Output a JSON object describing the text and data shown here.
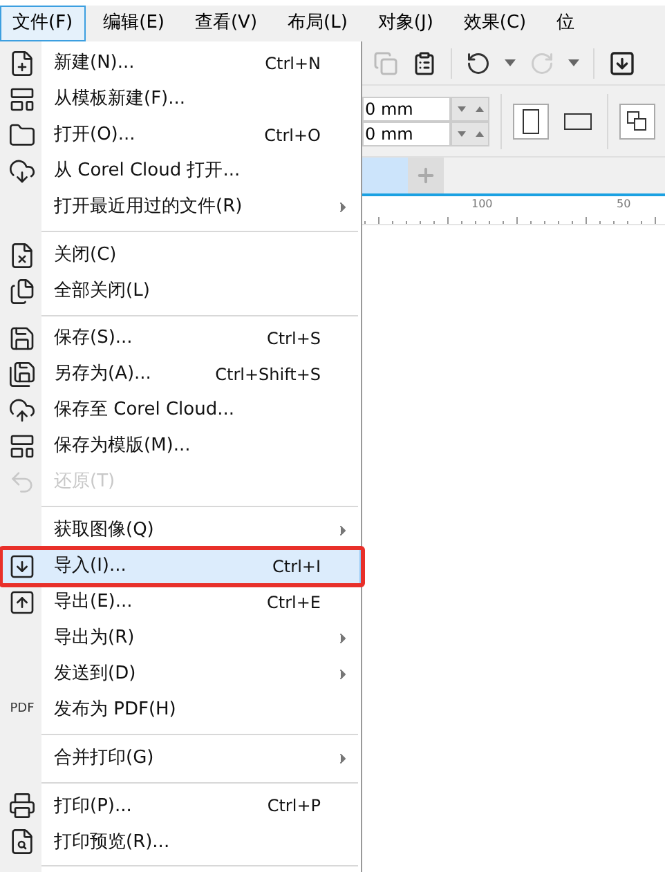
{
  "menubar": [
    {
      "label": "文件(F)",
      "selected": true
    },
    {
      "label": "编辑(E)",
      "selected": false
    },
    {
      "label": "查看(V)",
      "selected": false
    },
    {
      "label": "布局(L)",
      "selected": false
    },
    {
      "label": "对象(J)",
      "selected": false
    },
    {
      "label": "效果(C)",
      "selected": false
    },
    {
      "label": "位",
      "selected": false
    }
  ],
  "menu": [
    {
      "kind": "item",
      "label": "新建(N)...",
      "shortcut": "Ctrl+N",
      "submenu": false,
      "disabled": false,
      "selected": false,
      "outlined": false
    },
    {
      "kind": "item",
      "label": "从模板新建(F)...",
      "submenu": false,
      "disabled": false,
      "selected": false,
      "outlined": false
    },
    {
      "kind": "item",
      "label": "打开(O)...",
      "shortcut": "Ctrl+O",
      "submenu": false,
      "disabled": false,
      "selected": false,
      "outlined": false
    },
    {
      "kind": "item",
      "label": "从 Corel Cloud 打开...",
      "submenu": false,
      "disabled": false,
      "selected": false,
      "outlined": false
    },
    {
      "kind": "item",
      "label": "打开最近用过的文件(R)",
      "submenu": true,
      "disabled": false,
      "selected": false,
      "outlined": false
    },
    {
      "kind": "separator"
    },
    {
      "kind": "item",
      "label": "关闭(C)",
      "submenu": false,
      "disabled": false,
      "selected": false,
      "outlined": false
    },
    {
      "kind": "item",
      "label": "全部关闭(L)",
      "submenu": false,
      "disabled": false,
      "selected": false,
      "outlined": false
    },
    {
      "kind": "separator"
    },
    {
      "kind": "item",
      "label": "保存(S)...",
      "shortcut": "Ctrl+S",
      "submenu": false,
      "disabled": false,
      "selected": false,
      "outlined": false
    },
    {
      "kind": "item",
      "label": "另存为(A)...",
      "shortcut": "Ctrl+Shift+S",
      "submenu": false,
      "disabled": false,
      "selected": false,
      "outlined": false
    },
    {
      "kind": "item",
      "label": "保存至 Corel Cloud...",
      "submenu": false,
      "disabled": false,
      "selected": false,
      "outlined": false
    },
    {
      "kind": "item",
      "label": "保存为模版(M)...",
      "submenu": false,
      "disabled": false,
      "selected": false,
      "outlined": false
    },
    {
      "kind": "item",
      "label": "还原(T)",
      "submenu": false,
      "disabled": true,
      "selected": false,
      "outlined": false
    },
    {
      "kind": "separator"
    },
    {
      "kind": "item",
      "label": "获取图像(Q)",
      "submenu": true,
      "disabled": false,
      "selected": false,
      "outlined": false
    },
    {
      "kind": "item",
      "label": "导入(I)...",
      "shortcut": "Ctrl+I",
      "submenu": false,
      "disabled": false,
      "selected": true,
      "outlined": true
    },
    {
      "kind": "item",
      "label": "导出(E)...",
      "shortcut": "Ctrl+E",
      "submenu": false,
      "disabled": false,
      "selected": false,
      "outlined": false
    },
    {
      "kind": "item",
      "label": "导出为(R)",
      "submenu": true,
      "disabled": false,
      "selected": false,
      "outlined": false
    },
    {
      "kind": "item",
      "label": "发送到(D)",
      "submenu": true,
      "disabled": false,
      "selected": false,
      "outlined": false
    },
    {
      "kind": "item",
      "label": "发布为 PDF(H)",
      "icon_label": "PDF",
      "submenu": false,
      "disabled": false,
      "selected": false,
      "outlined": false
    },
    {
      "kind": "separator"
    },
    {
      "kind": "item",
      "label": "合并打印(G)",
      "submenu": true,
      "disabled": false,
      "selected": false,
      "outlined": false
    },
    {
      "kind": "separator"
    },
    {
      "kind": "item",
      "label": "打印(P)...",
      "shortcut": "Ctrl+P",
      "submenu": false,
      "disabled": false,
      "selected": false,
      "outlined": false
    },
    {
      "kind": "item",
      "label": "打印预览(R)...",
      "submenu": false,
      "disabled": false,
      "selected": false,
      "outlined": false
    },
    {
      "kind": "separator"
    }
  ],
  "fields": [
    {
      "value": "0 mm"
    },
    {
      "value": "0 mm"
    }
  ],
  "ruler": {
    "labels": [
      "100",
      "50"
    ]
  }
}
